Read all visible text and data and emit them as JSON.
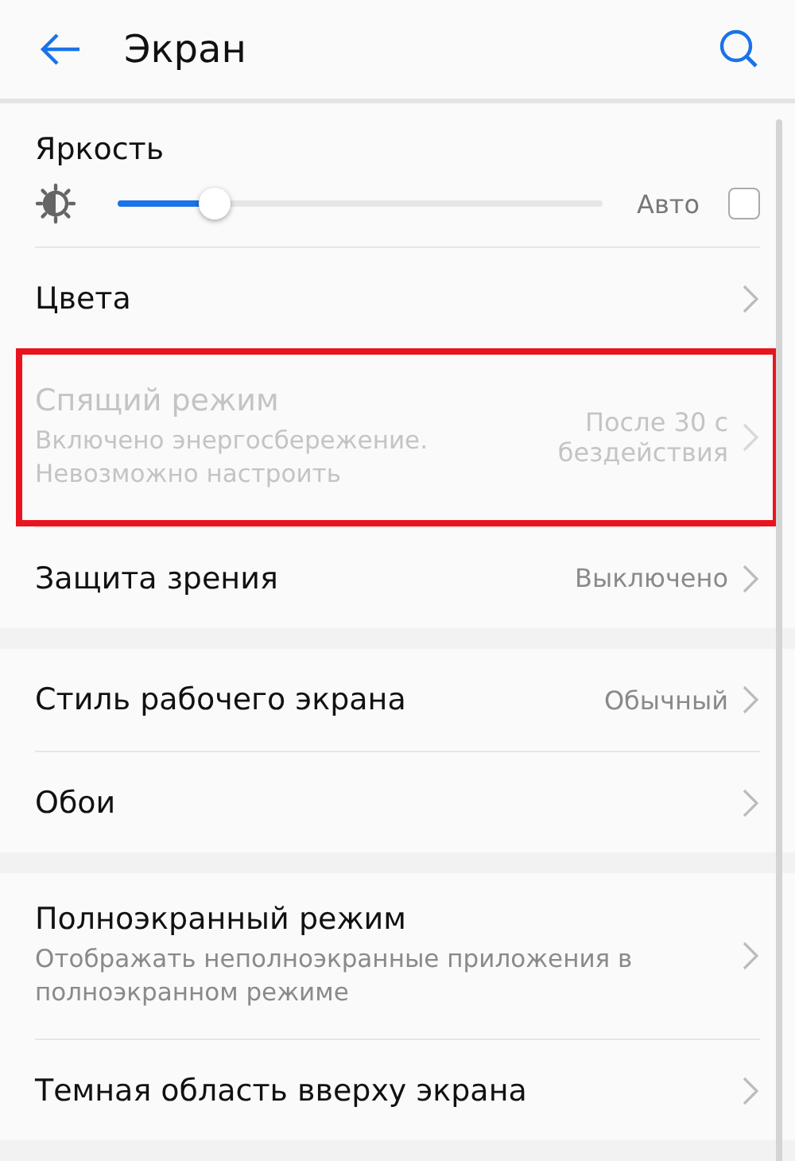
{
  "header": {
    "title": "Экран"
  },
  "sections": [
    {
      "items": [
        {
          "kind": "slider",
          "title": "Яркость",
          "level": 0.2,
          "auto_label": "Авто",
          "auto_checked": false
        },
        {
          "kind": "link",
          "title": "Цвета",
          "disabled": false,
          "highlighted": false
        },
        {
          "kind": "link",
          "title": "Спящий режим",
          "subtitle": "Включено энергосбережение. Невозможно настроить",
          "value": "После 30 с бездействия",
          "disabled": true,
          "highlighted": true
        },
        {
          "kind": "link",
          "title": "Защита зрения",
          "value": "Выключено",
          "disabled": false,
          "highlighted": false
        }
      ]
    },
    {
      "items": [
        {
          "kind": "link",
          "title": "Стиль рабочего экрана",
          "value": "Обычный",
          "disabled": false,
          "highlighted": false
        },
        {
          "kind": "link",
          "title": "Обои",
          "disabled": false,
          "highlighted": false
        }
      ]
    },
    {
      "items": [
        {
          "kind": "link",
          "title": "Полноэкранный режим",
          "subtitle": "Отображать неполноэкранные приложения в полноэкранном режиме",
          "disabled": false,
          "highlighted": false
        },
        {
          "kind": "link",
          "title": "Темная область вверху экрана",
          "disabled": false,
          "highlighted": false
        }
      ]
    }
  ]
}
